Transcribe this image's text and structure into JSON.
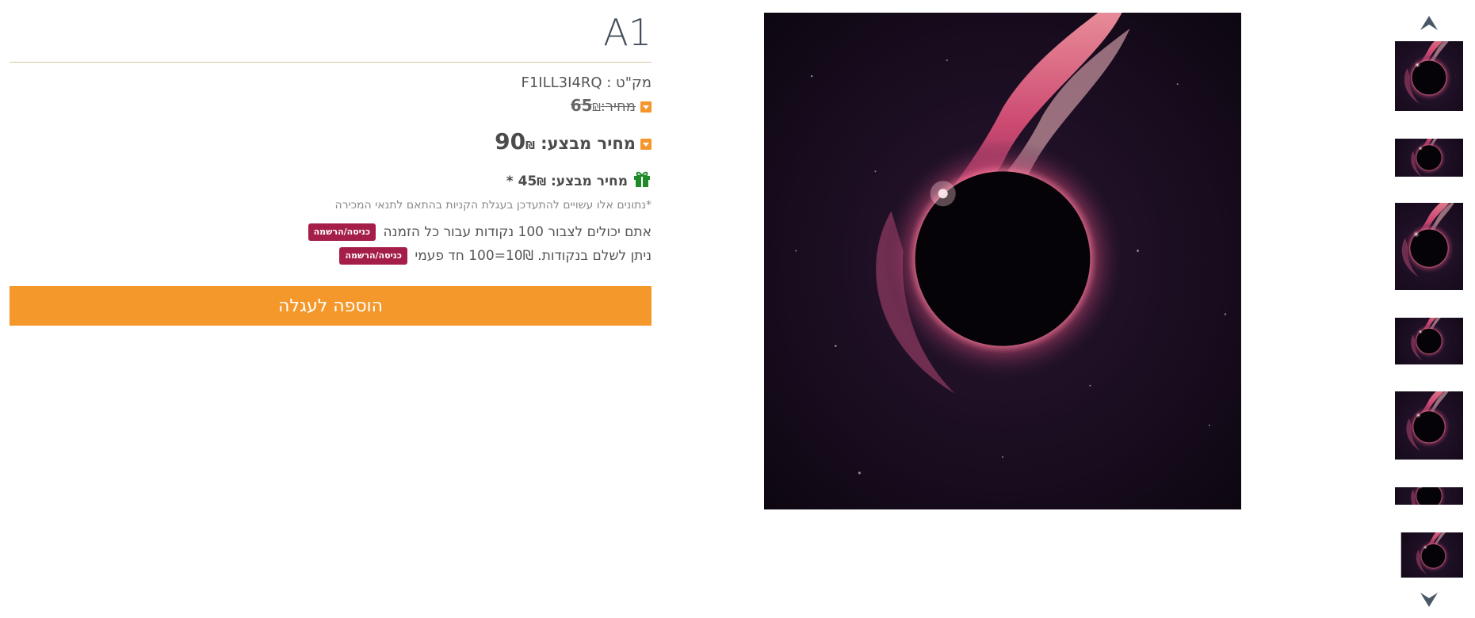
{
  "product": {
    "title": "A1",
    "sku_label": "מק\"ט : F1ILL3I4RQ",
    "old_price_label": "מחיר:",
    "old_price_value": "65",
    "sale_price_label": "מחיר מבצע:",
    "sale_price_value": "90",
    "members_price_label": "מחיר מבצע:",
    "members_price_value": "45",
    "members_price_suffix": "*",
    "currency": "₪",
    "note": "*נתונים אלו עשויים להתעדכן בעגלת הקניות בהתאם לתנאי המכירה",
    "points_earn_text": "אתם יכולים לצבור 100 נקודות עבור כל הזמנה",
    "points_pay_text": "ניתן לשלם בנקודות. 10₪=100 חד פעמי",
    "login_badge": "כניסה/הרשמה",
    "add_to_cart": "הוספה לעגלה"
  },
  "gallery": {
    "thumbnail_count": 7,
    "selected_index": 0
  },
  "colors": {
    "accent_orange": "#f5982c",
    "badge": "#a51e4a",
    "gift_green": "#1e8a2a",
    "title_rule": "#d4c79e"
  },
  "icons": {
    "price_marker": "triangle-down-icon",
    "gift": "gift-icon",
    "gallery_up": "chevron-up-icon",
    "gallery_down": "chevron-down-icon"
  }
}
